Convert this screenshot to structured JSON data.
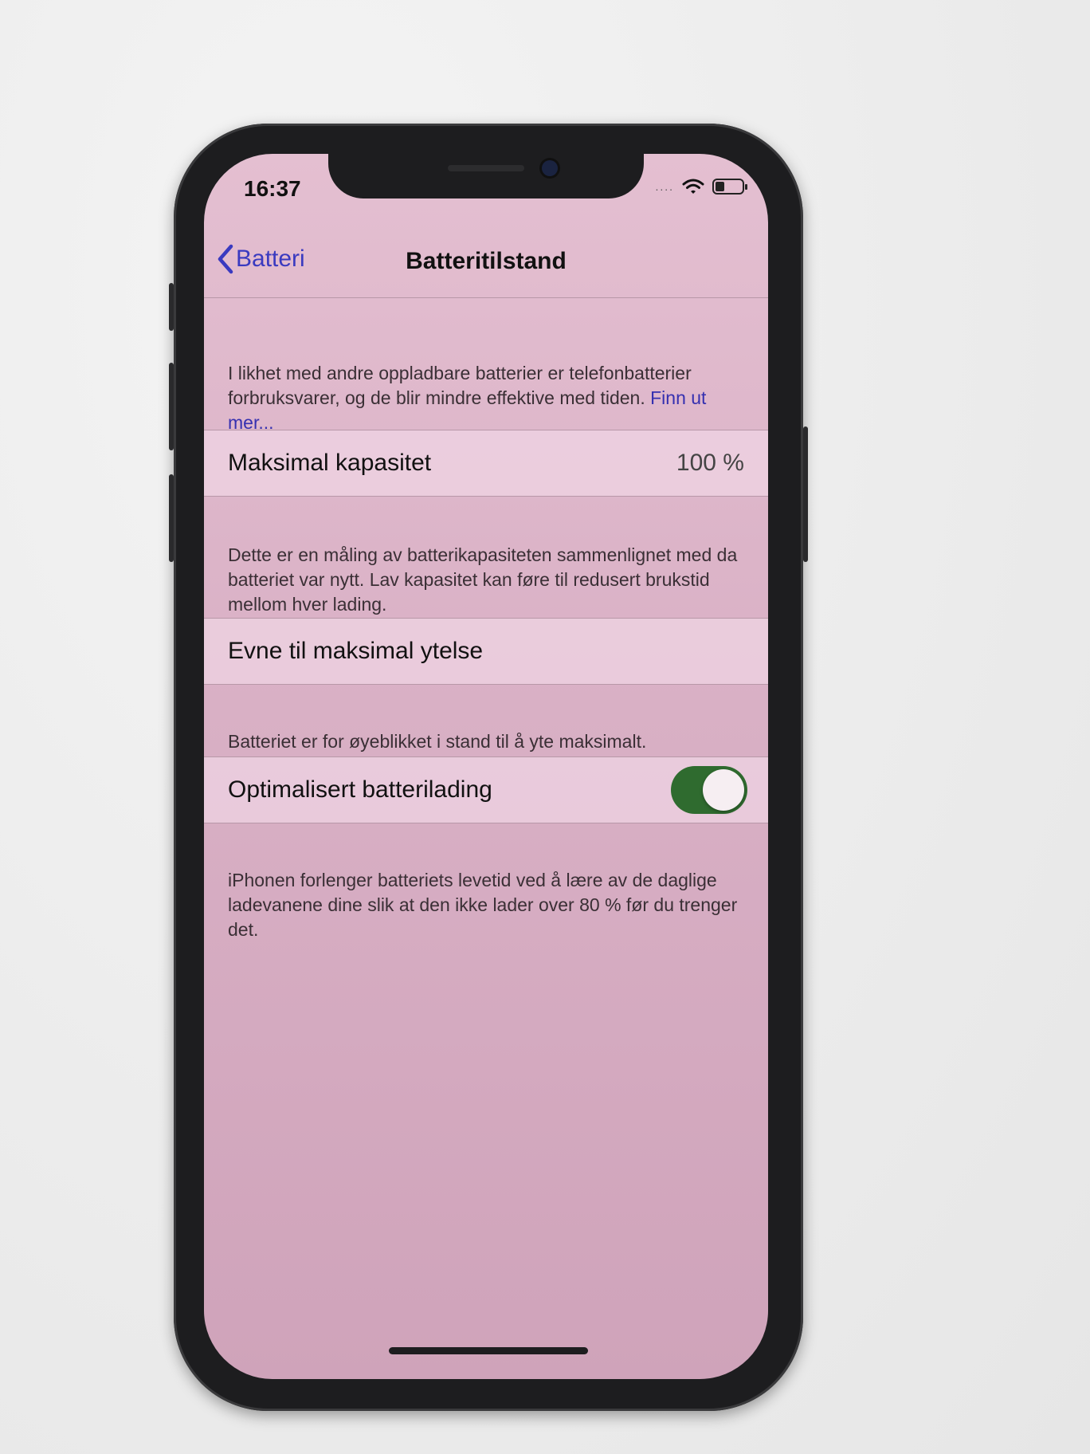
{
  "status": {
    "time": "16:37",
    "signal": "....",
    "battery_level": 0.35
  },
  "nav": {
    "back_label": "Batteri",
    "title": "Batteritilstand"
  },
  "intro": {
    "text": "I likhet med andre oppladbare batterier er telefonbatterier forbruksvarer, og de blir mindre effektive med tiden. ",
    "link": "Finn ut mer..."
  },
  "max_capacity": {
    "label": "Maksimal kapasitet",
    "value": "100 %",
    "footer": "Dette er en måling av batterikapasiteten sammenlignet med da batteriet var nytt. Lav kapasitet kan føre til redusert brukstid mellom hver lading."
  },
  "peak_performance": {
    "label": "Evne til maksimal ytelse",
    "footer": "Batteriet er for øyeblikket i stand til å yte maksimalt."
  },
  "optimized_charging": {
    "label": "Optimalisert batterilading",
    "enabled": true,
    "footer": "iPhonen forlenger batteriets levetid ved å lære av de daglige ladevanene dine slik at den ikke lader over 80 % før du trenger det."
  },
  "colors": {
    "accent": "#3a3ac0",
    "toggle_on": "#2f6b2f",
    "screen_tint": "#dcb4c8"
  }
}
